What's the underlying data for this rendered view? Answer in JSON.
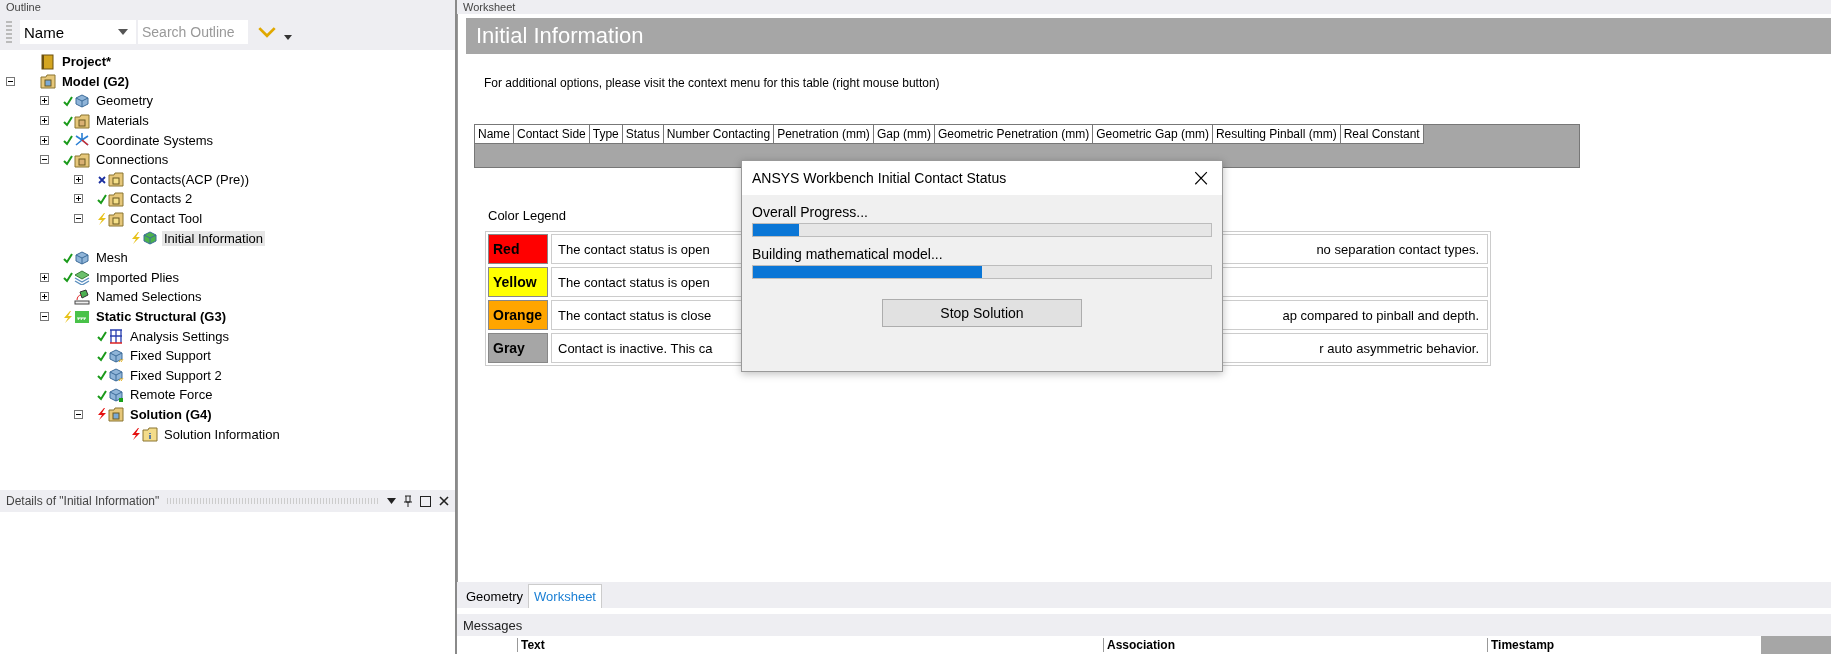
{
  "outline": {
    "title": "Outline",
    "sort": {
      "value": "Name"
    },
    "search": {
      "placeholder": "Search Outline"
    },
    "tree": [
      {
        "label": "Project*",
        "kind": "book",
        "bold": true,
        "solved": false,
        "suppressed": false,
        "outdated": false,
        "failed": false,
        "selected": false
      },
      {
        "label": "Model (G2)",
        "kind": "model",
        "bold": true,
        "expanded": true,
        "solved": false,
        "suppressed": false,
        "outdated": false,
        "failed": false,
        "selected": false,
        "children": [
          {
            "label": "Geometry",
            "kind": "cube",
            "bold": false,
            "expanded": false,
            "solved": true,
            "suppressed": false,
            "outdated": false,
            "failed": false,
            "selected": false
          },
          {
            "label": "Materials",
            "kind": "folder",
            "bold": false,
            "expanded": false,
            "solved": true,
            "suppressed": false,
            "outdated": false,
            "failed": false,
            "selected": false
          },
          {
            "label": "Coordinate Systems",
            "kind": "axes",
            "bold": false,
            "expanded": false,
            "solved": true,
            "suppressed": false,
            "outdated": false,
            "failed": false,
            "selected": false
          },
          {
            "label": "Connections",
            "kind": "folder",
            "bold": false,
            "expanded": true,
            "solved": true,
            "suppressed": false,
            "outdated": false,
            "failed": false,
            "selected": false,
            "children": [
              {
                "label": "Contacts(ACP (Pre))",
                "kind": "contact",
                "bold": false,
                "expanded": false,
                "solved": false,
                "suppressed": true,
                "outdated": false,
                "failed": false,
                "selected": false
              },
              {
                "label": "Contacts 2",
                "kind": "contact",
                "bold": false,
                "expanded": false,
                "solved": true,
                "suppressed": false,
                "outdated": false,
                "failed": false,
                "selected": false
              },
              {
                "label": "Contact Tool",
                "kind": "contact",
                "bold": false,
                "expanded": true,
                "solved": false,
                "suppressed": false,
                "outdated": true,
                "failed": false,
                "selected": false,
                "children": [
                  {
                    "label": "Initial Information",
                    "kind": "colorcube",
                    "bold": false,
                    "solved": false,
                    "suppressed": false,
                    "outdated": true,
                    "failed": false,
                    "selected": true
                  }
                ]
              }
            ]
          },
          {
            "label": "Mesh",
            "kind": "cube",
            "bold": false,
            "solved": true,
            "suppressed": false,
            "outdated": false,
            "failed": false,
            "selected": false
          },
          {
            "label": "Imported Plies",
            "kind": "layers",
            "bold": false,
            "expanded": false,
            "solved": true,
            "suppressed": false,
            "outdated": false,
            "failed": false,
            "selected": false
          },
          {
            "label": "Named Selections",
            "kind": "named",
            "bold": false,
            "expanded": false,
            "solved": false,
            "suppressed": false,
            "outdated": false,
            "failed": false,
            "selected": false
          },
          {
            "label": "Static Structural (G3)",
            "kind": "analysis",
            "bold": true,
            "expanded": true,
            "solved": false,
            "suppressed": false,
            "outdated": true,
            "failed": false,
            "selected": false,
            "children": [
              {
                "label": "Analysis Settings",
                "kind": "grid",
                "bold": false,
                "solved": true,
                "suppressed": false,
                "outdated": false,
                "failed": false,
                "selected": false
              },
              {
                "label": "Fixed Support",
                "kind": "support",
                "bold": false,
                "solved": true,
                "suppressed": false,
                "outdated": false,
                "failed": false,
                "selected": false
              },
              {
                "label": "Fixed Support 2",
                "kind": "support",
                "bold": false,
                "solved": true,
                "suppressed": false,
                "outdated": false,
                "failed": false,
                "selected": false
              },
              {
                "label": "Remote Force",
                "kind": "force",
                "bold": false,
                "solved": true,
                "suppressed": false,
                "outdated": false,
                "failed": false,
                "selected": false
              },
              {
                "label": "Solution (G4)",
                "kind": "model",
                "bold": true,
                "expanded": true,
                "solved": false,
                "suppressed": false,
                "outdated": false,
                "failed": true,
                "selected": false,
                "children": [
                  {
                    "label": "Solution Information",
                    "kind": "info",
                    "bold": false,
                    "solved": false,
                    "suppressed": false,
                    "outdated": false,
                    "failed": true,
                    "selected": false
                  }
                ]
              }
            ]
          }
        ]
      }
    ]
  },
  "details": {
    "title": "Details of \"Initial Information\""
  },
  "worksheet": {
    "title": "Worksheet",
    "heading": "Initial Information",
    "note": "For additional options, please visit the context menu for this table (right mouse button)",
    "table": {
      "columns": [
        "Name",
        "Contact Side",
        "Type",
        "Status",
        "Number Contacting",
        "Penetration (mm)",
        "Gap (mm)",
        "Geometric Penetration (mm)",
        "Geometric Gap (mm)",
        "Resulting Pinball (mm)",
        "Real Constant"
      ]
    },
    "legend": {
      "title": "Color Legend",
      "rows": [
        {
          "label": "Red",
          "color": "#ff0000",
          "text_left": "The contact status is open",
          "text_right": "no separation contact types."
        },
        {
          "label": "Yellow",
          "color": "#ffff00",
          "text_left": "The contact status is open"
        },
        {
          "label": "Orange",
          "color": "#ffa500",
          "text_left": "The contact status is close",
          "text_right": "ap compared to pinball and depth."
        },
        {
          "label": "Gray",
          "color": "#a6a6a6",
          "text_left": "Contact is inactive. This ca",
          "text_right": "r auto asymmetric behavior."
        }
      ]
    }
  },
  "dialog": {
    "title": "ANSYS Workbench Initial Contact Status",
    "close": "×",
    "progress": [
      {
        "label": "Overall Progress...",
        "level": 0.1
      },
      {
        "label": "Building mathematical model...",
        "level": 0.5
      }
    ],
    "button": "Stop Solution"
  },
  "bottom_tabs": [
    {
      "label": "Geometry",
      "selected": false
    },
    {
      "label": "Worksheet",
      "selected": true
    }
  ],
  "messages": {
    "title": "Messages",
    "columns": [
      "Text",
      "Association",
      "Timestamp"
    ]
  }
}
